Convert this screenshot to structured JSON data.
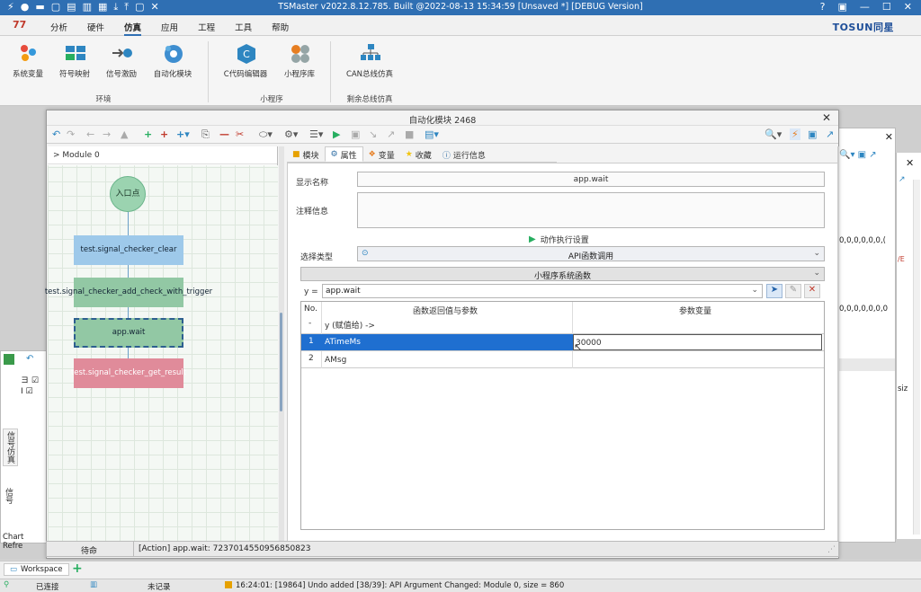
{
  "app": {
    "title": "TSMaster v2022.8.12.785. Built @2022-08-13 15:34:59 [Unsaved *] [DEBUG Version]",
    "brand": "TOSUN同星",
    "help_icon": "?"
  },
  "menu": {
    "logo": "77",
    "items": [
      "分析",
      "硬件",
      "仿真",
      "应用",
      "工程",
      "工具",
      "帮助"
    ],
    "active": "仿真"
  },
  "ribbon": {
    "buttons": [
      {
        "label": "系统变量",
        "icon": "molecule-icon"
      },
      {
        "label": "符号映射",
        "icon": "map-icon"
      },
      {
        "label": "信号激励",
        "icon": "signal-icon"
      },
      {
        "label": "自动化模块",
        "icon": "automation-icon"
      },
      {
        "label": "C代码编辑器",
        "icon": "c-code-icon"
      },
      {
        "label": "小程序库",
        "icon": "library-icon"
      },
      {
        "label": "CAN总线仿真",
        "icon": "can-bus-icon"
      }
    ],
    "groups": [
      "环境",
      "小程序",
      "剩余总线仿真"
    ]
  },
  "dialog": {
    "title": "自动化模块 2468",
    "breadcrumb": "> Module 0",
    "flow": {
      "entry": "入口点",
      "nodes": [
        {
          "label": "test.signal_checker_clear",
          "color": "#9ec9ea",
          "text": "#123"
        },
        {
          "label": "test.signal_checker_add_check_with_trigger",
          "color": "#92c8a4",
          "text": "#123"
        },
        {
          "label": "app.wait",
          "color": "#92c8a4",
          "text": "#123",
          "selected": true
        },
        {
          "label": "test.signal_checker_get_result",
          "color": "#e08b9a",
          "text": "#fff"
        }
      ]
    },
    "tabs": [
      {
        "label": "模块",
        "icon": "module-icon"
      },
      {
        "label": "属性",
        "icon": "gear-icon",
        "active": true
      },
      {
        "label": "变量",
        "icon": "variable-icon"
      },
      {
        "label": "收藏",
        "icon": "star-icon"
      },
      {
        "label": "运行信息",
        "icon": "info-icon"
      }
    ],
    "props": {
      "display_name_label": "显示名称",
      "display_name_value": "app.wait",
      "comment_label": "注释信息",
      "comment_value": "",
      "exec_settings": "动作执行设置",
      "select_type_label": "选择类型",
      "select_type_value": "API函数调用",
      "category_value": "小程序系统函数",
      "api_prefix": "y =",
      "api_value": "app.wait"
    },
    "grid": {
      "col_no": "No.",
      "col_dash": "-",
      "col_func": "函数返回值与参数",
      "col_func_sub": "y (赋值给) ->",
      "col_param": "参数变量",
      "rows": [
        {
          "no": "1",
          "name": "ATimeMs",
          "value": "30000",
          "selected": true
        },
        {
          "no": "2",
          "name": "AMsg",
          "value": "",
          "selected": false
        }
      ]
    },
    "status_left": "待命",
    "status_msg": "[Action] app.wait: 72370145509568508​23"
  },
  "right_bg": {
    "values1": "0,0,0,0,0,0,(",
    "values2": "0,0,0,0,0,0,0",
    "values3": "0,0,0,0,0,0,0",
    "tag": "/E",
    "siz": "siz"
  },
  "left_bg": {
    "chart_refresh": "Chart Refre",
    "vertical1": "信号仿真",
    "vertical2": "信号"
  },
  "bottom": {
    "workspace": "Workspace",
    "plus": "+"
  },
  "app_status": {
    "connected": "已连接",
    "record": "未记录",
    "log": "16:24:01: [19864] Undo added [38/39]: API Argument Changed: Module 0, size = 860"
  }
}
